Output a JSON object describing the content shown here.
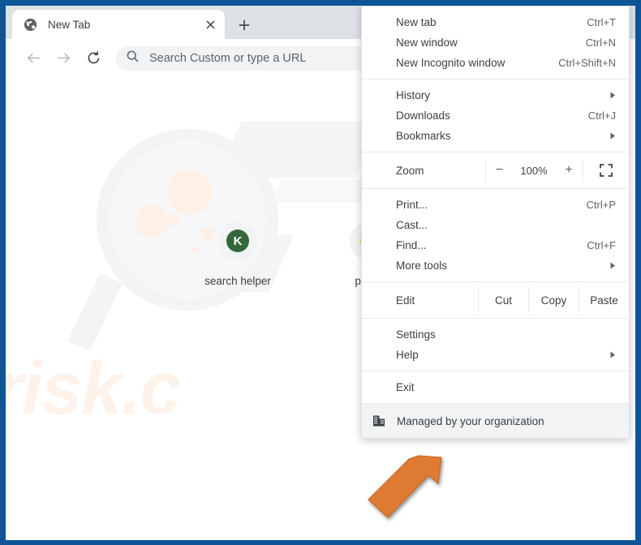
{
  "window": {
    "frame_color": "#0d5596",
    "titlebar_color": "#dee1e6",
    "controls": {
      "minimize_label": "–",
      "maximize_label": "☐",
      "close_label": "×",
      "download_indicator": "chevron-down-circle"
    }
  },
  "tabstrip": {
    "tabs": [
      {
        "title": "New Tab",
        "favicon": "globe-icon",
        "close_label": "×",
        "active": true
      }
    ],
    "new_tab_label": "+"
  },
  "toolbar": {
    "back_icon": "arrow-left-icon",
    "forward_icon": "arrow-right-icon",
    "reload_icon": "reload-icon",
    "omnibox": {
      "search_icon": "search-icon",
      "placeholder": "Search Custom or type a URL",
      "value": ""
    },
    "bookmark_icon": "star-icon",
    "profile_icon": "person-icon",
    "menu_icon": "three-dots-vertical-icon"
  },
  "newtab": {
    "watermarks": {
      "magnifier": "magnifier-watermark",
      "brand_text": "risk.c",
      "brand_color": "#f07a28"
    },
    "shortcuts": [
      {
        "label": "search helper",
        "icon_type": "letter",
        "letter": "K",
        "color": "#34683a"
      },
      {
        "label": "pcrisk",
        "icon_type": "google",
        "letter": "G",
        "color": "#4285f4"
      }
    ]
  },
  "chrome_menu": {
    "groups": [
      {
        "items": [
          {
            "label": "New tab",
            "accel": "Ctrl+T",
            "submenu": false
          },
          {
            "label": "New window",
            "accel": "Ctrl+N",
            "submenu": false
          },
          {
            "label": "New Incognito window",
            "accel": "Ctrl+Shift+N",
            "submenu": false
          }
        ]
      },
      {
        "items": [
          {
            "label": "History",
            "accel": "",
            "submenu": true
          },
          {
            "label": "Downloads",
            "accel": "Ctrl+J",
            "submenu": false
          },
          {
            "label": "Bookmarks",
            "accel": "",
            "submenu": true
          }
        ]
      }
    ],
    "zoom_row": {
      "label": "Zoom",
      "minus_label": "−",
      "level": "100%",
      "plus_label": "+",
      "fullscreen_icon": "fullscreen-icon"
    },
    "group3": {
      "items": [
        {
          "label": "Print...",
          "accel": "Ctrl+P",
          "submenu": false
        },
        {
          "label": "Cast...",
          "accel": "",
          "submenu": false
        },
        {
          "label": "Find...",
          "accel": "Ctrl+F",
          "submenu": false
        },
        {
          "label": "More tools",
          "accel": "",
          "submenu": true
        }
      ]
    },
    "edit_row": {
      "label": "Edit",
      "cut_label": "Cut",
      "copy_label": "Copy",
      "paste_label": "Paste"
    },
    "group4": {
      "items": [
        {
          "label": "Settings",
          "accel": "",
          "submenu": false
        },
        {
          "label": "Help",
          "accel": "",
          "submenu": true
        }
      ]
    },
    "group5": {
      "items": [
        {
          "label": "Exit",
          "accel": "",
          "submenu": false
        }
      ]
    },
    "managed_row": {
      "label": "Managed by your organization",
      "icon": "office-building-icon",
      "highlighted": true
    }
  },
  "annotation": {
    "arrow_icon": "orange-arrow-up-right",
    "arrow_color": "#e07b39"
  }
}
